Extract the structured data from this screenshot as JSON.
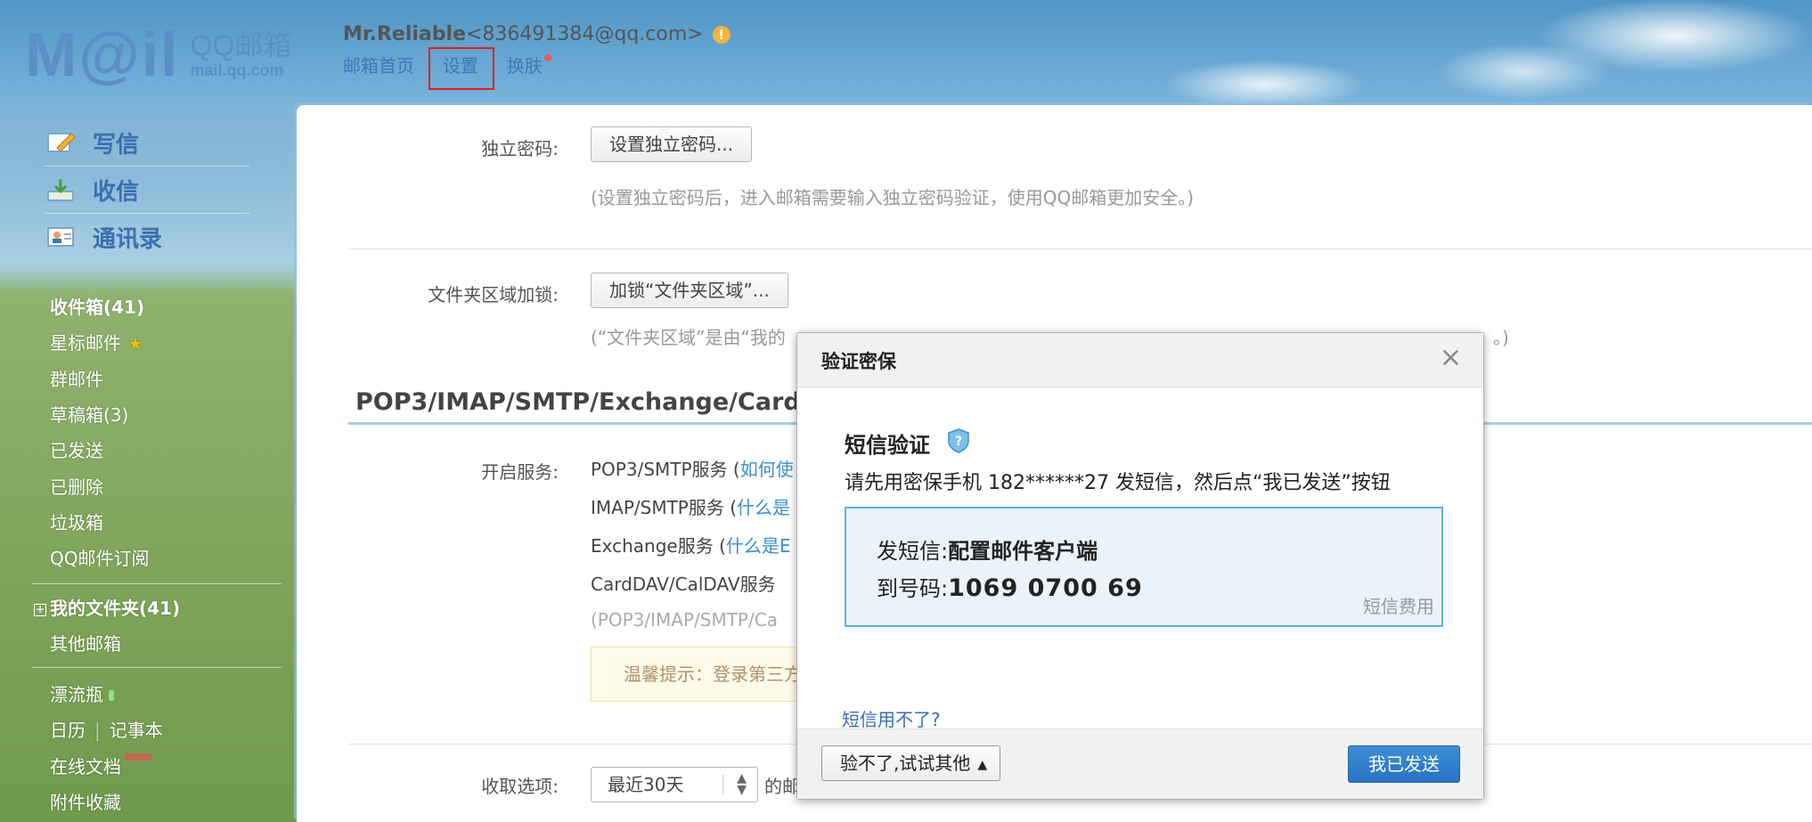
{
  "header": {
    "logo_text": "M@il",
    "logo_brand": "QQ邮箱",
    "logo_url": "mail.qq.com",
    "user_name": "Mr.Reliable",
    "user_email": "<836491384@qq.com>",
    "warn_icon_glyph": "!",
    "nav": {
      "home": "邮箱首页",
      "settings": "设置",
      "sep": "-",
      "skin": "换肤"
    }
  },
  "sidebar": {
    "actions": {
      "compose": "写信",
      "inbox": "收信",
      "contacts": "通讯录"
    },
    "folders": {
      "inbox": "收件箱(41)",
      "starred": "星标邮件",
      "star_glyph": "★",
      "group": "群邮件",
      "drafts": "草稿箱(3)",
      "sent": "已发送",
      "deleted": "已删除",
      "trash": "垃圾箱",
      "subscriptions": "QQ邮件订阅",
      "my_folders": "我的文件夹(41)",
      "other_mail": "其他邮箱",
      "bottle": "漂流瓶",
      "calendar": "日历",
      "notebook": "记事本",
      "online_docs": "在线文档",
      "attachments": "附件收藏"
    }
  },
  "main": {
    "password_label": "独立密码:",
    "password_button": "设置独立密码...",
    "password_note": "(设置独立密码后，进入邮箱需要输入独立密码验证，使用QQ邮箱更加安全。)",
    "folder_lock_label": "文件夹区域加锁:",
    "folder_lock_button": "加锁“文件夹区域”...",
    "folder_lock_note": "(“文件夹区域”是由“我的",
    "folder_lock_note_tail": "。)",
    "section_title": "POP3/IMAP/SMTP/Exchange/CardD",
    "service_label": "开启服务:",
    "services": [
      {
        "name": "POP3/SMTP服务 (",
        "link": "如何使"
      },
      {
        "name": "IMAP/SMTP服务 (",
        "link": "什么是"
      },
      {
        "name": "Exchange服务 (",
        "link": "什么是E"
      },
      {
        "name": "CardDAV/CalDAV服务",
        "link": ""
      }
    ],
    "service_note": "(POP3/IMAP/SMTP/Ca",
    "tip_text": "温馨提示：登录第三方",
    "fetch_label": "收取选项:",
    "fetch_value": "最近30天",
    "fetch_suffix": "的邮"
  },
  "modal": {
    "title": "验证密保",
    "close_glyph": "×",
    "sms_title": "短信验证",
    "sms_desc": "请先用密保手机 182******27 发短信，然后点“我已发送”按钮",
    "send_label": "发短信:",
    "send_content": "配置邮件客户端",
    "to_label": "到号码:",
    "to_number": "1069 0700 69",
    "fee_link": "短信费用",
    "help_link": "短信用不了?",
    "other_button": "验不了,试试其他",
    "other_arrow": "▲",
    "sent_button": "我已发送"
  },
  "colors": {
    "accent": "#2673c2",
    "link": "#3b8ed0",
    "highlight_box": "#e02020"
  }
}
